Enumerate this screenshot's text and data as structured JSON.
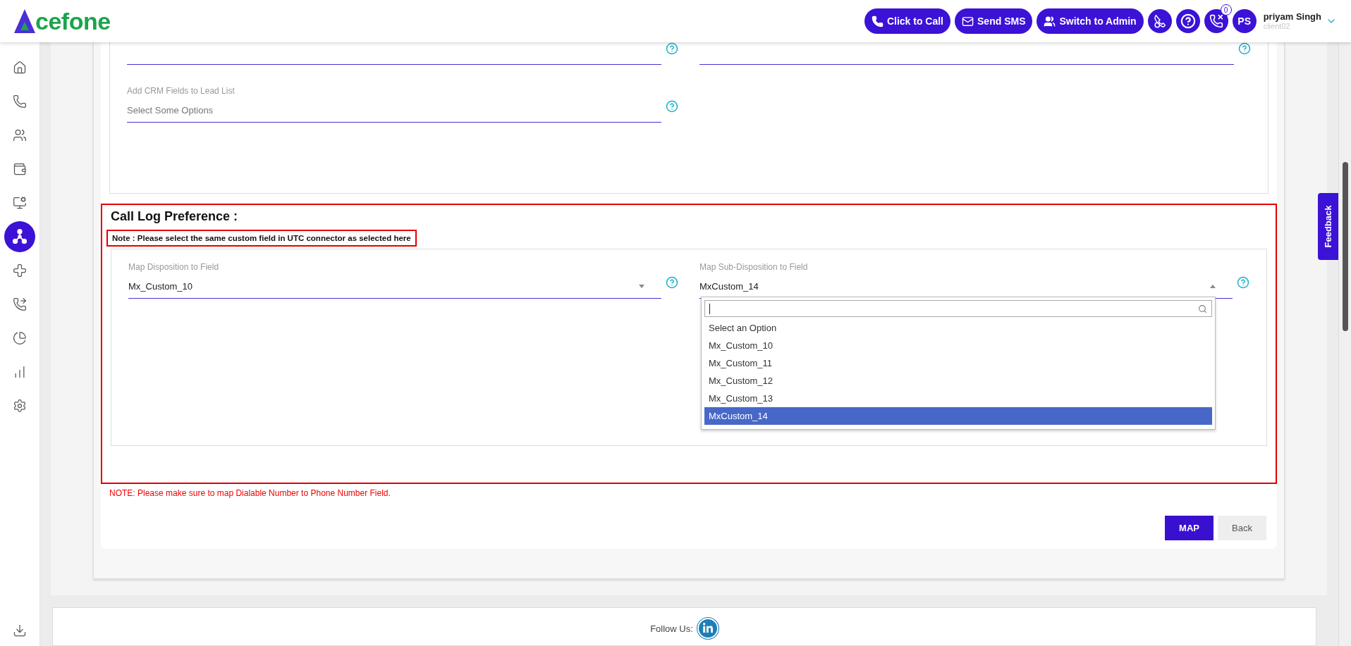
{
  "header": {
    "logo_text": "cefone",
    "actions": [
      {
        "label": "Click to Call"
      },
      {
        "label": "Send SMS"
      },
      {
        "label": "Switch to Admin"
      }
    ],
    "round_buttons": [
      {
        "kind": "icon"
      },
      {
        "kind": "help"
      },
      {
        "kind": "badge",
        "badge": "0"
      }
    ],
    "user": {
      "initials": "PS",
      "name": "priyam Singh",
      "account": "client02"
    }
  },
  "sidebar": {
    "items": [
      {
        "selected": false
      },
      {
        "selected": false
      },
      {
        "selected": false
      },
      {
        "selected": false
      },
      {
        "selected": false
      },
      {
        "selected": true
      },
      {
        "selected": false
      },
      {
        "selected": false
      },
      {
        "selected": false
      },
      {
        "selected": false
      },
      {
        "selected": false
      }
    ]
  },
  "top_section": {
    "rows": [
      [
        {
          "help": true
        },
        {
          "help": true
        }
      ],
      [
        {
          "label": "Add CRM Fields to Lead List",
          "placeholder": "Select Some Options"
        }
      ]
    ]
  },
  "call_log": {
    "title": "Call Log Preference :",
    "note": "Note : Please select the same custom field in UTC connector as selected here",
    "fields": [
      {
        "label": "Map Disposition to Field",
        "value": "Mx_Custom_10",
        "open": false
      },
      {
        "label": "Map Sub-Disposition to Field",
        "value": "MxCustom_14",
        "open": true,
        "options": [
          {
            "label": "Select an Option",
            "selected": false
          },
          {
            "label": "Mx_Custom_10",
            "selected": false
          },
          {
            "label": "Mx_Custom_11",
            "selected": false
          },
          {
            "label": "Mx_Custom_12",
            "selected": false
          },
          {
            "label": "Mx_Custom_13",
            "selected": false
          },
          {
            "label": "MxCustom_14",
            "selected": true
          }
        ]
      }
    ]
  },
  "warning": "NOTE: Please make sure to map Dialable Number to Phone Number Field.",
  "buttons": [
    {
      "label": "MAP",
      "kind": "primary"
    },
    {
      "label": "Back",
      "kind": "secondary"
    }
  ],
  "footer": {
    "label": "Follow Us:"
  },
  "feedback": "Feedback"
}
